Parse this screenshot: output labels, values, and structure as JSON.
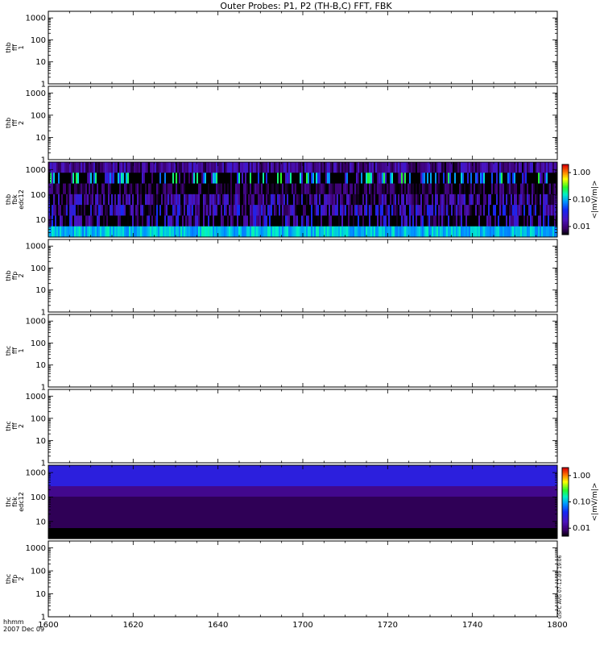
{
  "title": "Outer Probes: P1, P2 (TH-B,C) FFT, FBK",
  "time_axis": {
    "label_line1": "hhmm",
    "label_line2": "2007 Dec 09",
    "ticks": [
      "1600",
      "1620",
      "1640",
      "1700",
      "1720",
      "1740",
      "1800"
    ]
  },
  "colorbar": {
    "label": "<|mV/m|>",
    "ticks": [
      "1.00",
      "0.10",
      "0.01"
    ]
  },
  "side_annotation": "GSFC AVG 07-12-09 19:06",
  "chart_data": [
    {
      "panel": 1,
      "type": "heatmap",
      "label": [
        "thb",
        "fff",
        "1"
      ],
      "ylim": [
        1,
        2000
      ],
      "ylog": true,
      "yticks": [
        "1000",
        "100",
        "10",
        "1"
      ],
      "has_data": false
    },
    {
      "panel": 2,
      "type": "heatmap",
      "label": [
        "thb",
        "fff",
        "2"
      ],
      "ylim": [
        1,
        2000
      ],
      "ylog": true,
      "yticks": [
        "1000",
        "100",
        "10",
        "1"
      ],
      "has_data": false
    },
    {
      "panel": 3,
      "type": "heatmap",
      "label": [
        "thb",
        "fbk",
        "edc12"
      ],
      "ylim": [
        2,
        2000
      ],
      "ylog": true,
      "yticks": [
        "1000",
        "100",
        "10"
      ],
      "has_data": true,
      "colorbar": true,
      "zlog": true,
      "zlim": [
        0.005,
        2.0
      ],
      "bands": [
        {
          "name": "band6",
          "base": 0.01,
          "spread": 0.6,
          "black_frac": 0.02
        },
        {
          "name": "band5",
          "base": 0.03,
          "spread": 1.6,
          "black_frac": 0.55
        },
        {
          "name": "band4",
          "base": 0.006,
          "spread": 0.5,
          "black_frac": 0.15
        },
        {
          "name": "band3",
          "base": 0.009,
          "spread": 0.8,
          "black_frac": 0.2
        },
        {
          "name": "band2",
          "base": 0.012,
          "spread": 0.9,
          "black_frac": 0.35
        },
        {
          "name": "band1",
          "base": 0.01,
          "spread": 1.0,
          "black_frac": 0.45
        },
        {
          "name": "band0",
          "base": 0.1,
          "spread": 0.4,
          "black_frac": 0.0
        }
      ]
    },
    {
      "panel": 4,
      "type": "heatmap",
      "label": [
        "thb",
        "ffp",
        "2"
      ],
      "ylim": [
        1,
        2000
      ],
      "ylog": true,
      "yticks": [
        "1000",
        "100",
        "10",
        "1"
      ],
      "has_data": false
    },
    {
      "panel": 5,
      "type": "heatmap",
      "label": [
        "thc",
        "fff",
        "1"
      ],
      "ylim": [
        1,
        2000
      ],
      "ylog": true,
      "yticks": [
        "1000",
        "100",
        "10",
        "1"
      ],
      "has_data": false
    },
    {
      "panel": 6,
      "type": "heatmap",
      "label": [
        "thc",
        "fff",
        "2"
      ],
      "ylim": [
        1,
        2000
      ],
      "ylog": true,
      "yticks": [
        "1000",
        "100",
        "10",
        "1"
      ],
      "has_data": false
    },
    {
      "panel": 7,
      "type": "heatmap",
      "label": [
        "thc",
        "fbk",
        "edc12"
      ],
      "ylim": [
        2,
        2000
      ],
      "ylog": true,
      "yticks": [
        "1000",
        "100",
        "10"
      ],
      "has_data": true,
      "colorbar": true,
      "zlog": true,
      "zlim": [
        0.005,
        2.0
      ],
      "uniform_bands": [
        0.03,
        0.03,
        0.012,
        0.008,
        0.008,
        0.008,
        0.002
      ]
    },
    {
      "panel": 8,
      "type": "heatmap",
      "label": [
        "thc",
        "ffp",
        "2"
      ],
      "ylim": [
        1,
        2000
      ],
      "ylog": true,
      "yticks": [
        "1000",
        "100",
        "10",
        "1"
      ],
      "has_data": false
    }
  ]
}
